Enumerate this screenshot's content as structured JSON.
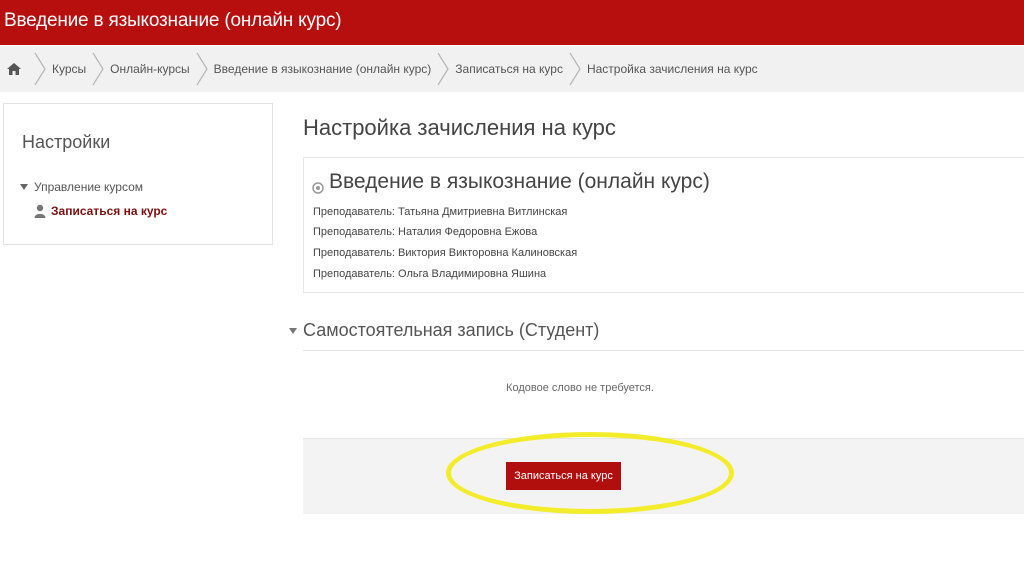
{
  "header": {
    "title": "Введение в языкознание (онлайн курс)"
  },
  "breadcrumb": {
    "home_icon": "home-icon",
    "items": [
      "Курсы",
      "Онлайн-курсы",
      "Введение в языкознание (онлайн курс)",
      "Записаться на курс",
      "Настройка зачисления на курс"
    ]
  },
  "sidebar": {
    "title": "Настройки",
    "group_label": "Управление курсом",
    "item_label": "Записаться на курс"
  },
  "main": {
    "page_title": "Настройка зачисления на курс",
    "course": {
      "name": "Введение в языкознание (онлайн курс)",
      "teachers": [
        "Преподаватель: Татьяна Дмитриевна Витлинская",
        "Преподаватель: Наталия Федоровна Ежова",
        "Преподаватель: Виктория Викторовна Калиновская",
        "Преподаватель: Ольга Владимировна Яшина"
      ]
    },
    "section_title": "Самостоятельная запись (Студент)",
    "no_keyword": "Кодовое слово не требуется.",
    "enroll_button": "Записаться на курс"
  },
  "colors": {
    "brand": "#b70e0e",
    "highlight": "#f3ec2b"
  }
}
